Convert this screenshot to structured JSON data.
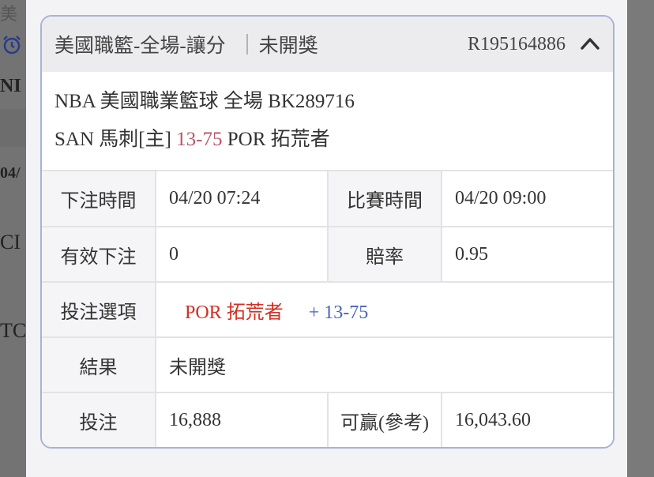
{
  "background": {
    "tab_text": "美",
    "row_1": "NI",
    "row_2": "04/",
    "row_3": "CI",
    "row_4": "TC"
  },
  "card": {
    "title": "美國職籃-全場-讓分",
    "status": "未開獎",
    "bet_id": "R195164886",
    "match_line": "NBA 美國職業籃球 全場 BK289716",
    "teams": {
      "home": "SAN 馬刺[主]",
      "score": "13-75",
      "away": "POR 拓荒者"
    },
    "details": {
      "bet_time_label": "下注時間",
      "bet_time": "04/20 07:24",
      "match_time_label": "比賽時間",
      "match_time": "04/20 09:00",
      "valid_bet_label": "有效下注",
      "valid_bet": "0",
      "odds_label": "賠率",
      "odds": "0.95",
      "selection_label": "投注選項",
      "selection_team": "POR 拓荒者",
      "selection_handicap": "+ 13-75",
      "result_label": "結果",
      "result": "未開獎",
      "stake_label": "投注",
      "stake": "16,888",
      "win_label": "可贏(參考)",
      "win": "16,043.60"
    }
  },
  "colors": {
    "accent_red": "#b85464",
    "pick_red": "#d42f24",
    "handicap_blue": "#4a62b8",
    "card_border": "#a9b2d6"
  },
  "icons": {
    "header_toggle": "chevron-up-icon",
    "background_alarm": "alarm-icon"
  }
}
